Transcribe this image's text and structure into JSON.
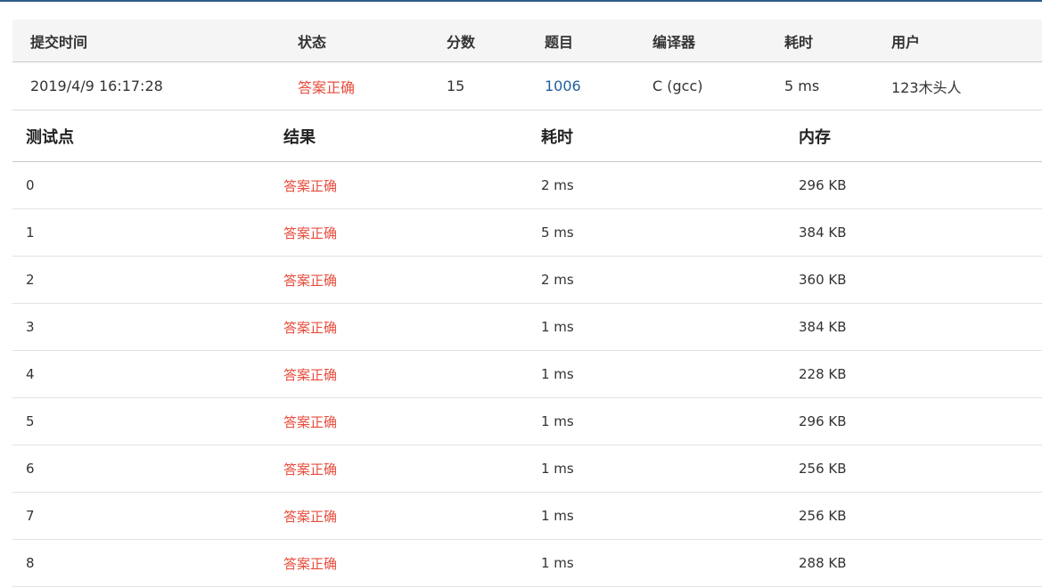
{
  "submission": {
    "headers": {
      "time": "提交时间",
      "status": "状态",
      "score": "分数",
      "problem": "题目",
      "compiler": "编译器",
      "elapsed": "耗时",
      "user": "用户"
    },
    "row": {
      "time": "2019/4/9 16:17:28",
      "status": "答案正确",
      "score": "15",
      "problem": "1006",
      "compiler": "C (gcc)",
      "elapsed": "5 ms",
      "user": "123木头人"
    }
  },
  "cases": {
    "headers": {
      "id": "测试点",
      "result": "结果",
      "time": "耗时",
      "memory": "内存"
    },
    "rows": [
      {
        "id": "0",
        "result": "答案正确",
        "time": "2 ms",
        "memory": "296 KB"
      },
      {
        "id": "1",
        "result": "答案正确",
        "time": "5 ms",
        "memory": "384 KB"
      },
      {
        "id": "2",
        "result": "答案正确",
        "time": "2 ms",
        "memory": "360 KB"
      },
      {
        "id": "3",
        "result": "答案正确",
        "time": "1 ms",
        "memory": "384 KB"
      },
      {
        "id": "4",
        "result": "答案正确",
        "time": "1 ms",
        "memory": "228 KB"
      },
      {
        "id": "5",
        "result": "答案正确",
        "time": "1 ms",
        "memory": "296 KB"
      },
      {
        "id": "6",
        "result": "答案正确",
        "time": "1 ms",
        "memory": "256 KB"
      },
      {
        "id": "7",
        "result": "答案正确",
        "time": "1 ms",
        "memory": "256 KB"
      },
      {
        "id": "8",
        "result": "答案正确",
        "time": "1 ms",
        "memory": "288 KB"
      }
    ]
  },
  "colors": {
    "accepted": "#e74c3c",
    "link": "#1f5f9c",
    "top_border": "#2f5d8c"
  }
}
